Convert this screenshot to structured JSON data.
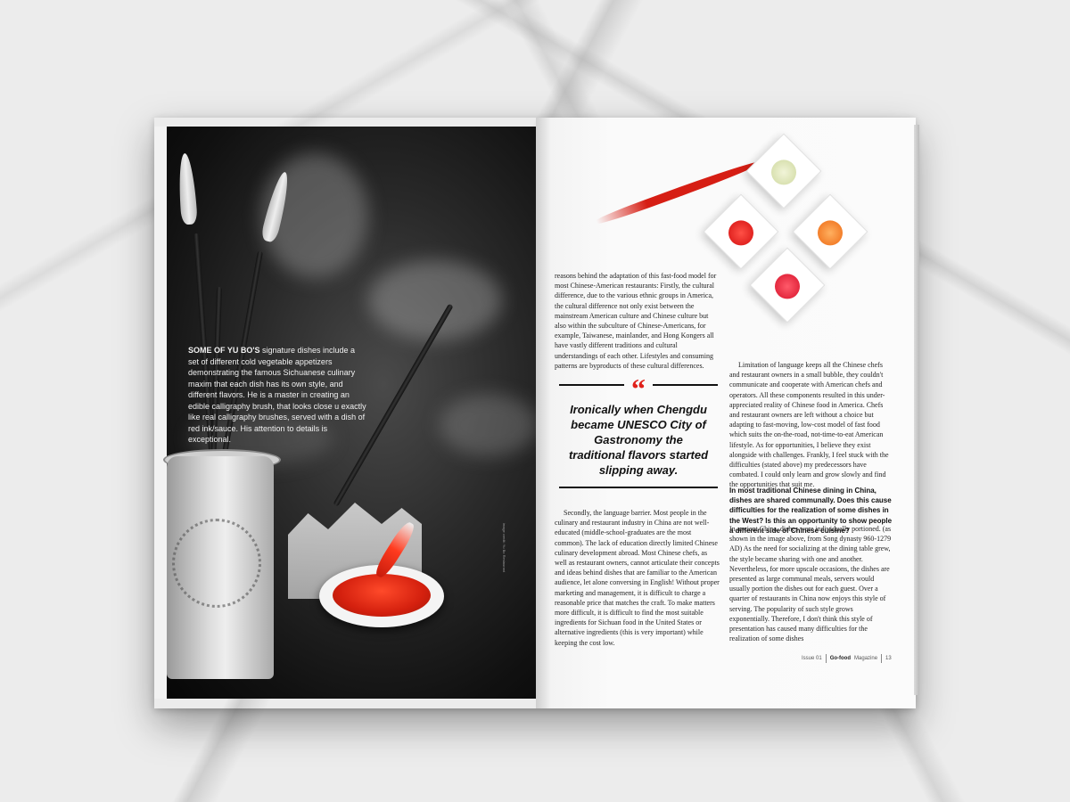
{
  "caption": {
    "lead": "SOME OF YU BO'S",
    "body": " signature dishes include a set of different cold vegetable appetizers demonstrating the famous Sichuanese culinary maxim that each dish has its own style, and different flavors. He is a master in creating an edible calligraphy brush, that looks close u exactly like real calligraphy brushes, served with a dish of red ink/sauce. His attention to details is exceptional."
  },
  "photo_credit": "image credit: Yu Bo Restaurant",
  "column1_top": "reasons behind the adaptation of this fast-food model for most Chinese-American restaurants: Firstly, the cultural difference, due to the various ethnic groups in America, the cultural difference not only exist between the mainstream American culture and Chinese culture but also within the subculture of Chinese-Americans, for example, Taiwanese, mainlander, and Hong Kongers all have vastly different traditions and cultural understandings of each other. Lifestyles and consuming patterns are byproducts of these cultural differences.",
  "pull_quote": {
    "mark": "“",
    "text": "Ironically when Chengdu became UNESCO City of Gastronomy the traditional flavors started slipping away."
  },
  "column1_bottom": "Secondly, the language barrier. Most people in the culinary and restaurant industry in China are not well-educated (middle-school-graduates are the most common). The lack of education directly limited Chinese culinary development abroad. Most Chinese chefs, as well as restaurant owners, cannot articulate their concepts and ideas behind dishes that are familiar to the American audience, let alone conversing in English! Without proper marketing and management, it is difficult to charge a reasonable price that matches the craft. To make matters more difficult, it is difficult to find the most suitable ingredients for Sichuan food in the United States or alternative ingredients (this is very important) while keeping the cost low.",
  "column2_top": "Limitation of language keeps all the Chinese chefs and restaurant owners in a small bubble, they couldn't communicate and cooperate with American chefs and operators. All these components resulted in this under-appreciated reality of Chinese food in America. Chefs and restaurant owners are left without a choice but adapting to fast-moving, low-cost model of fast food which suits the on-the-road, not-time-to-eat American lifestyle. As for opportunities, I believe they exist alongside with challenges. Frankly, I feel stuck with the difficulties (stated above) my predecessors have combated. I could only learn and grow slowly and find the opportunities that suit me.",
  "question": "In most traditional Chinese dining in China, dishes are shared communally. Does this cause difficulties for the realization of some dishes in the West? Is this an opportunity to show people a different side of Chinese cuisine?",
  "answer": "In ancient China, dishes were individually portioned. (as shown in the image above, from Song dynasty 960-1279 AD) As the need for socializing at the dining table grew, the style became sharing with one and another. Nevertheless, for more upscale occasions, the dishes are presented as large communal meals, servers would usually portion the dishes out for each guest. Over a quarter of restaurants in China now enjoys this style of serving. The popularity of such style grows exponentially. Therefore, I don't think this style of presentation has caused many difficulties for the realization of some dishes",
  "footer": {
    "issue": "Issue 01",
    "brand": "Go-food",
    "magazine": "Magazine",
    "page": "13"
  },
  "colors": {
    "accent_red": "#e0201a",
    "text": "#222222",
    "page": "#fbfbfb"
  }
}
